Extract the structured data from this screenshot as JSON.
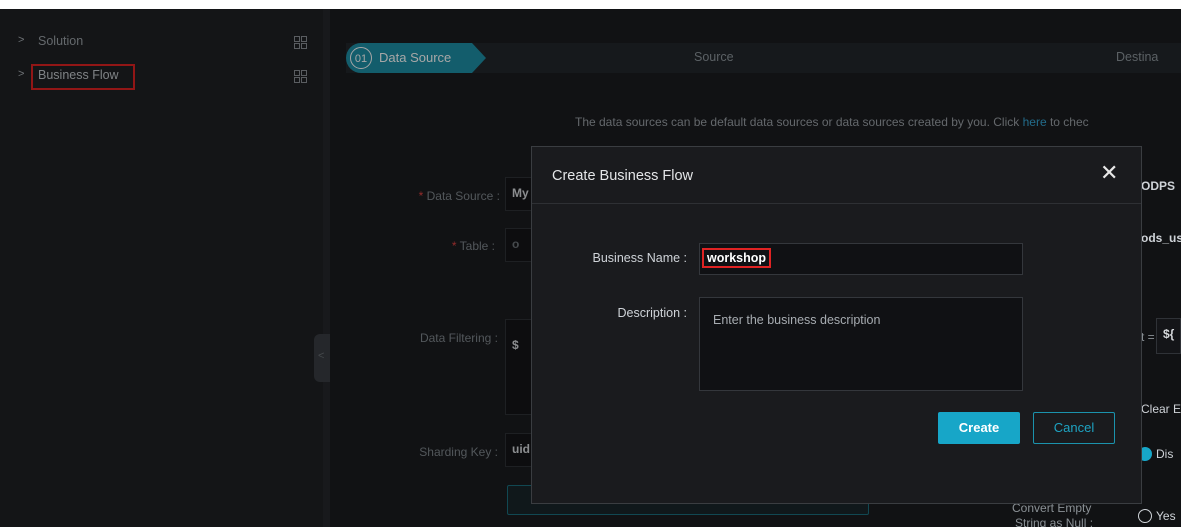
{
  "sidebar": {
    "items": [
      {
        "label": "Solution"
      },
      {
        "label": "Business Flow"
      }
    ]
  },
  "steps": {
    "step1_num": "01",
    "step1_label": "Data Source",
    "step2_label": "Source",
    "step3_label": "Destina"
  },
  "info": {
    "text_before": "The data sources can be default data sources or data sources created by you. Click ",
    "link": "here",
    "text_after": " to chec"
  },
  "form": {
    "data_source_label": "Data Source",
    "data_source_value": "My",
    "table_label": "Table",
    "table_value": "o",
    "data_filtering_label": "Data Filtering",
    "data_filtering_value": "$",
    "sharding_key_label": "Sharding Key",
    "sharding_key_value": "uid"
  },
  "right_partial": {
    "odps": "ODPS",
    "ods": "ods_us",
    "partition": "t =",
    "partition_value": "${",
    "clear": "Clear E",
    "radio1": "Dis",
    "empty_label_1": "Convert Empty",
    "empty_label_2": "String as Null",
    "radio2": "Yes"
  },
  "modal": {
    "title": "Create Business Flow",
    "close_glyph": "✕",
    "business_name_label": "Business Name :",
    "business_name_value": "workshop",
    "description_label": "Description :",
    "description_placeholder": "Enter the business description",
    "create_label": "Create",
    "cancel_label": "Cancel"
  },
  "colors": {
    "accent": "#17a6c8",
    "highlight": "#e02323",
    "background": "#1b1c1f"
  }
}
